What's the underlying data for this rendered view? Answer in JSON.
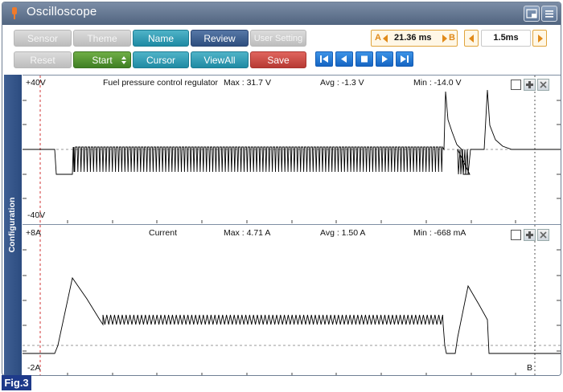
{
  "app": {
    "title": "Oscilloscope"
  },
  "toolbar": {
    "row1": [
      "Sensor",
      "Theme",
      "Name",
      "Review",
      "User Setting"
    ],
    "row2": {
      "reset": "Reset",
      "start": "Start",
      "cursor": "Cursor",
      "viewall": "ViewAll",
      "save": "Save"
    }
  },
  "cursor_box": {
    "a_label": "A",
    "value": "21.36 ms",
    "b_label": "B"
  },
  "timebase": {
    "value": "1.5ms"
  },
  "sidebar": {
    "label": "Configuration"
  },
  "channels": [
    {
      "name": "Fuel pressure control regulator",
      "max": "Max : 31.7 V",
      "avg": "Avg : -1.3 V",
      "min": "Min : -14.0 V",
      "y_top_label": "+40V",
      "y_bottom_label": "-40V"
    },
    {
      "name": "Current",
      "max": "Max : 4.71 A",
      "avg": "Avg : 1.50 A",
      "min": "Min : -668 mA",
      "y_top_label": "+8A",
      "y_bottom_label": "-2A",
      "cursor_label": "B"
    }
  ],
  "figure_label": "Fig.3",
  "colors": {
    "titlebar": "#5d7090",
    "teal": "#2a96ad",
    "navy": "#38588a",
    "green": "#4a8a2c",
    "red": "#c44a42",
    "cursor": "#cc2222"
  }
}
